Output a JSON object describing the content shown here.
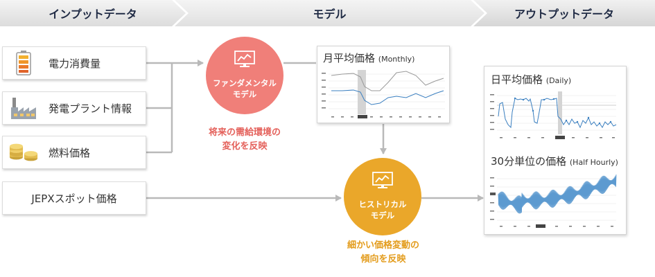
{
  "header": {
    "input": "インプットデータ",
    "model": "モデル",
    "output": "アウトプットデータ"
  },
  "inputs": [
    {
      "label": "電力消費量",
      "icon": "battery-icon"
    },
    {
      "label": "発電プラント情報",
      "icon": "factory-icon"
    },
    {
      "label": "燃料価格",
      "icon": "coins-icon"
    },
    {
      "label": "JEPXスポット価格"
    }
  ],
  "models": {
    "fundamental": {
      "line1": "ファンダメンタル",
      "line2": "モデル",
      "caption1": "将来の需給環境の",
      "caption2": "変化を反映",
      "color": "#f07f79"
    },
    "historical": {
      "line1": "ヒストリカル",
      "line2": "モデル",
      "caption1": "細かい価格変動の",
      "caption2": "傾向を反映",
      "color": "#eaa72a"
    }
  },
  "outputs": {
    "monthly": {
      "title": "月平均価格",
      "title_en": "(Monthly)"
    },
    "daily": {
      "title": "日平均価格",
      "title_en": "(Daily)"
    },
    "half_hourly": {
      "title": "30分単位の価格",
      "title_en": "(Half Hourly)"
    }
  },
  "colors": {
    "header_text": "#1f2a44",
    "arrow": "#b9b9b9",
    "line_blue": "#3a7fc0",
    "line_gray": "#9a9a9a"
  }
}
